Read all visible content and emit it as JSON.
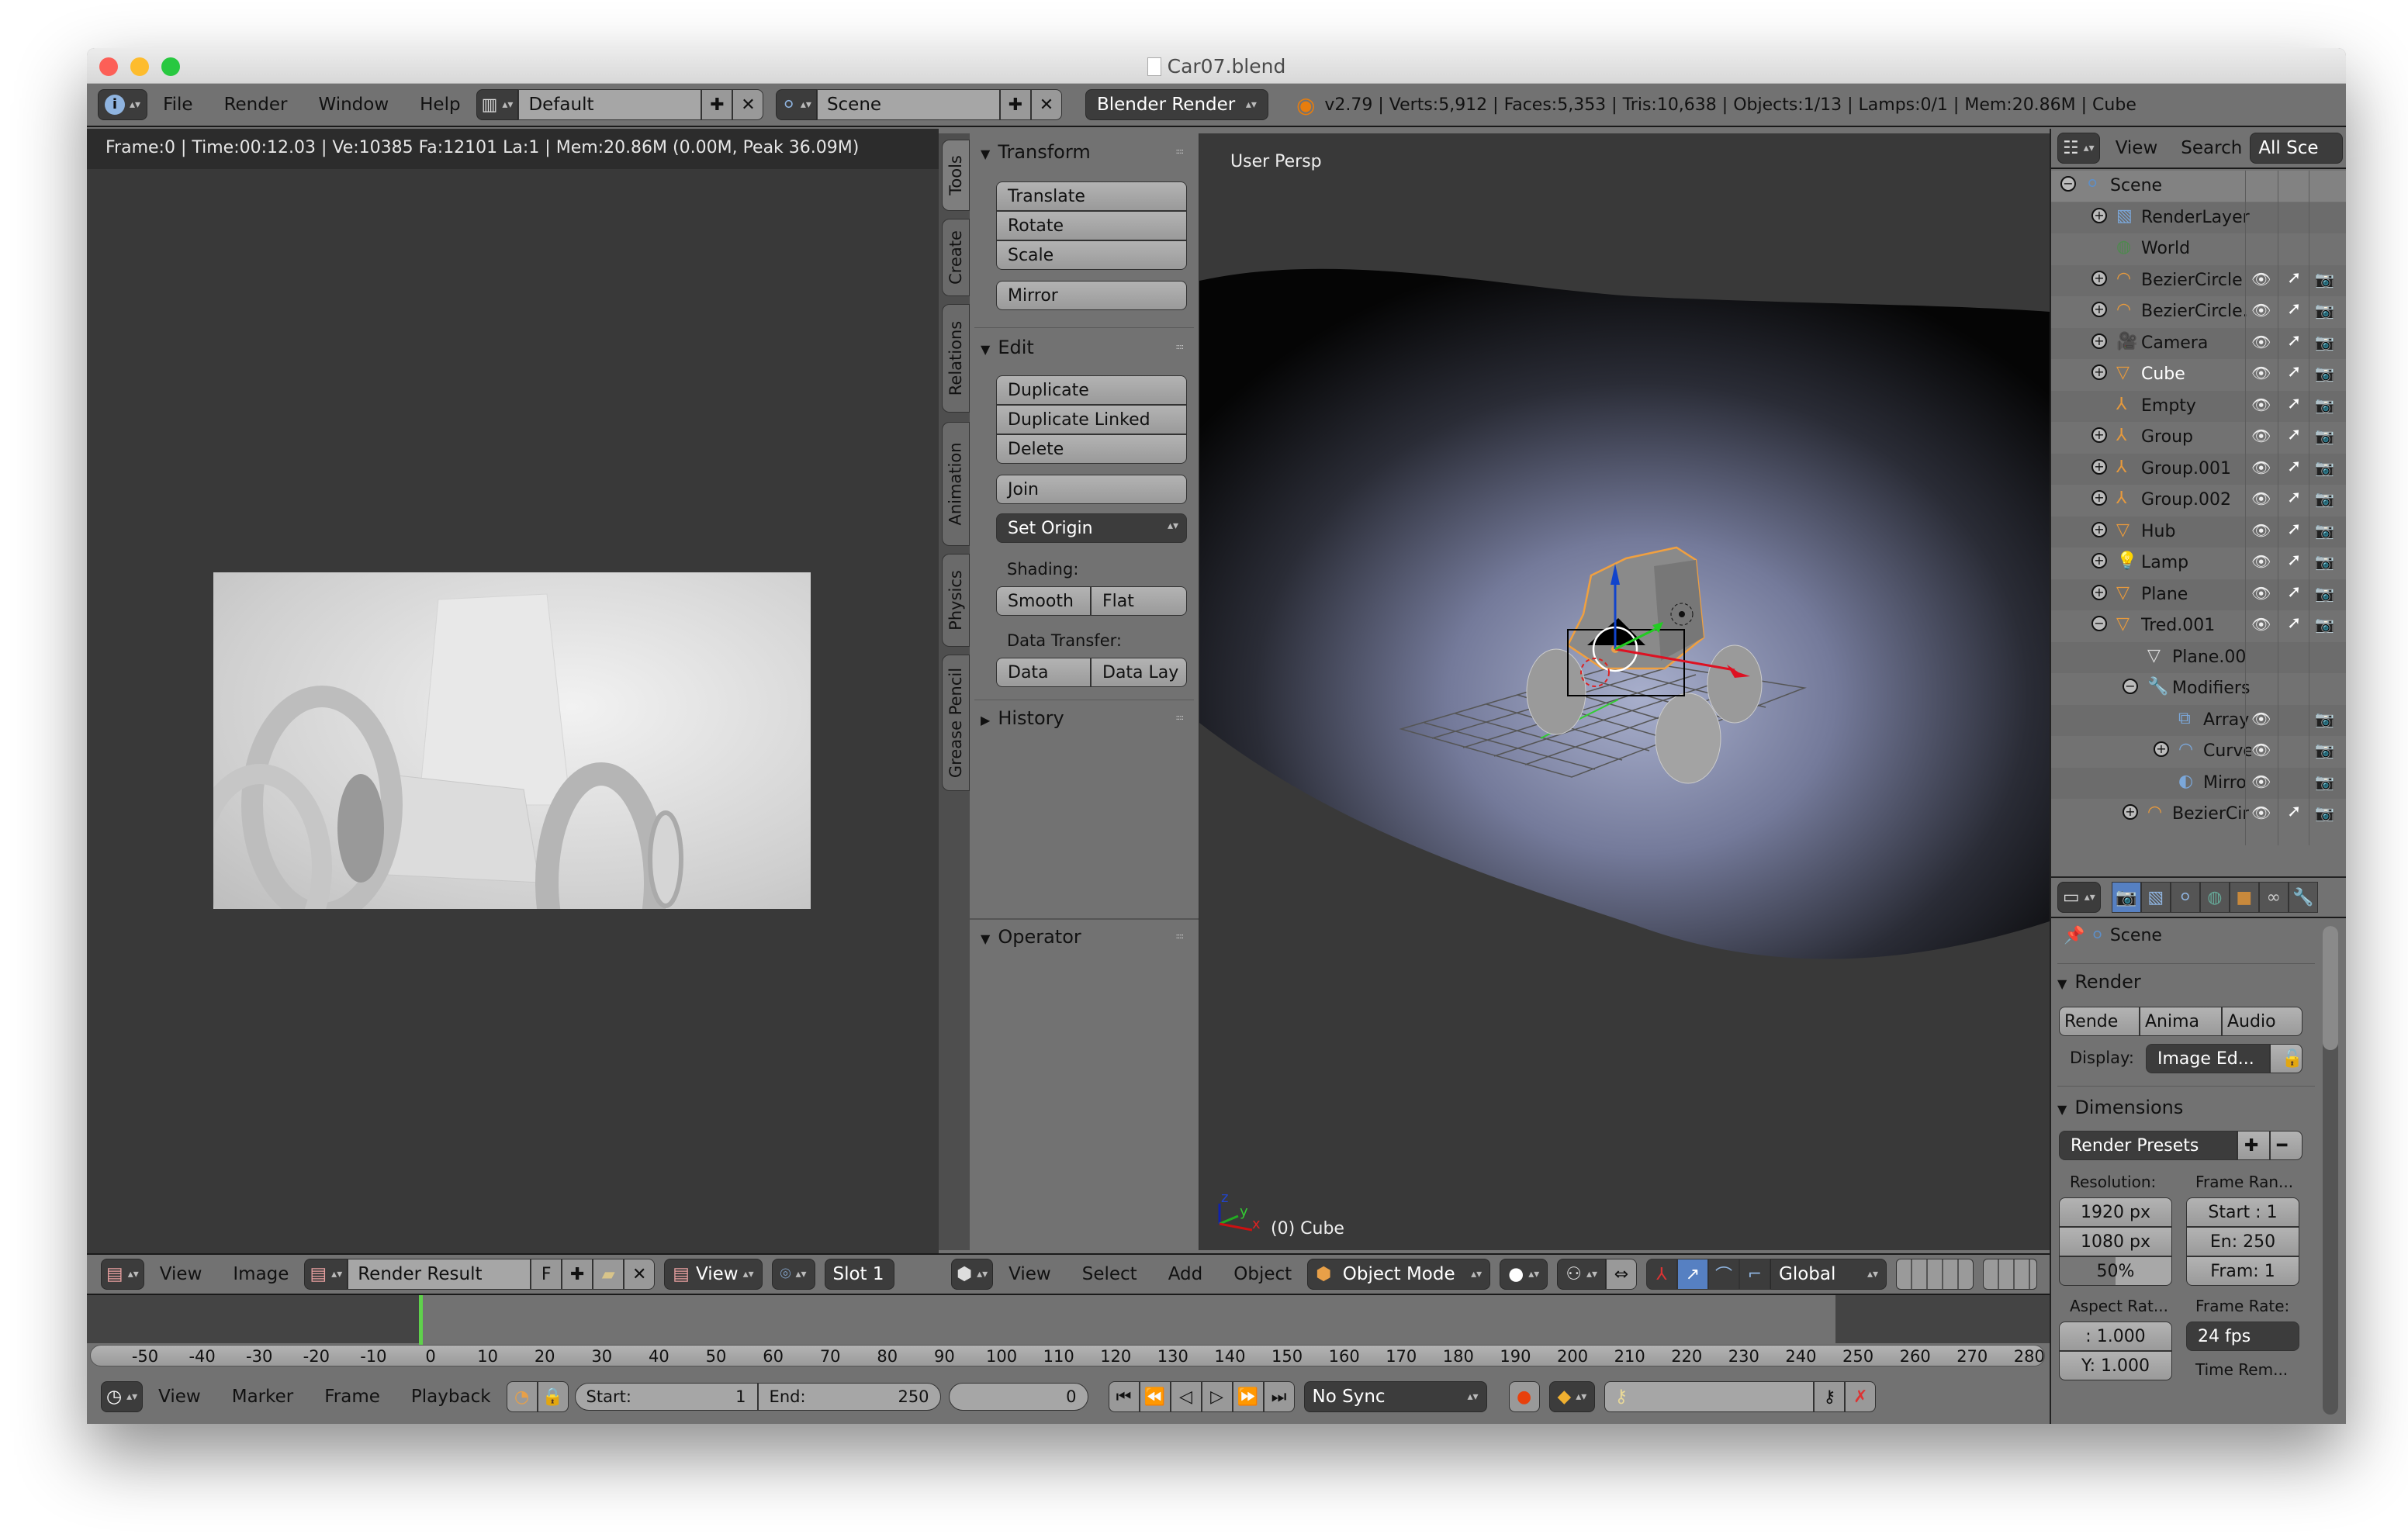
{
  "window": {
    "title": "Car07.blend",
    "traffic_lights": {
      "close": "#fc5f57",
      "minimize": "#fdbc2e",
      "zoom": "#28c840"
    }
  },
  "info_header": {
    "menus": [
      "File",
      "Render",
      "Window",
      "Help"
    ],
    "screen_layout": "Default",
    "scene": "Scene",
    "engine": "Blender Render",
    "stats": "v2.79 | Verts:5,912 | Faces:5,353 | Tris:10,638 | Objects:1/13 | Lamps:0/1 | Mem:20.86M | Cube"
  },
  "image_editor": {
    "render_info": "Frame:0 | Time:00:12.03 | Ve:10385 Fa:12101 La:1 | Mem:20.86M (0.00M, Peak 36.09M)",
    "header": {
      "menus": [
        "View",
        "Image"
      ],
      "image_name": "Render Result",
      "fake_user": "F",
      "view_mode": "View",
      "slot": "Slot 1"
    }
  },
  "tool_tabs": [
    "Tools",
    "Create",
    "Relations",
    "Animation",
    "Physics",
    "Grease Pencil"
  ],
  "tool_panel": {
    "transform": {
      "title": "Transform",
      "buttons": [
        "Translate",
        "Rotate",
        "Scale"
      ],
      "mirror": "Mirror"
    },
    "edit": {
      "title": "Edit",
      "buttons": [
        "Duplicate",
        "Duplicate Linked",
        "Delete"
      ],
      "join": "Join",
      "set_origin": "Set Origin",
      "shading_label": "Shading:",
      "shading": [
        "Smooth",
        "Flat"
      ],
      "data_transfer_label": "Data Transfer:",
      "data_transfer": [
        "Data",
        "Data Lay"
      ]
    },
    "history": {
      "title": "History"
    },
    "operator": {
      "title": "Operator"
    }
  },
  "viewport": {
    "view_name": "User Persp",
    "object_label": "(0) Cube",
    "axes": {
      "x": "x",
      "y": "y",
      "z": "z"
    },
    "header": {
      "menus": [
        "View",
        "Select",
        "Add",
        "Object"
      ],
      "mode": "Object Mode",
      "orientation": "Global"
    }
  },
  "outliner": {
    "header": {
      "menus": [
        "View",
        "Search"
      ],
      "filter": "All Sce"
    },
    "rows": [
      {
        "name": "Scene",
        "indent": 0,
        "expand": "minus",
        "icon": "scene",
        "color": "#5d8fc9",
        "vis": false
      },
      {
        "name": "RenderLayer",
        "indent": 1,
        "expand": "plus",
        "icon": "renderlayer",
        "color": "#7ba7d9",
        "vis": false
      },
      {
        "name": "World",
        "indent": 1,
        "expand": "",
        "icon": "world",
        "color": "#4d8a4d",
        "vis": false
      },
      {
        "name": "BezierCircle",
        "indent": 1,
        "expand": "plus",
        "icon": "curve",
        "color": "#e89a3c",
        "vis": true,
        "sel": true
      },
      {
        "name": "BezierCircle.",
        "indent": 1,
        "expand": "plus",
        "icon": "curve",
        "color": "#e89a3c",
        "vis": true,
        "sel": true
      },
      {
        "name": "Camera",
        "indent": 1,
        "expand": "plus",
        "icon": "camera",
        "color": "#e89a3c",
        "vis": true,
        "sel": true
      },
      {
        "name": "Cube",
        "indent": 1,
        "expand": "plus",
        "icon": "mesh",
        "color": "#e89a3c",
        "vis": true,
        "sel": true,
        "active": true
      },
      {
        "name": "Empty",
        "indent": 1,
        "expand": "",
        "icon": "empty",
        "color": "#e89a3c",
        "vis": true,
        "sel": true
      },
      {
        "name": "Group",
        "indent": 1,
        "expand": "plus",
        "icon": "empty",
        "color": "#e89a3c",
        "vis": true,
        "sel": true
      },
      {
        "name": "Group.001",
        "indent": 1,
        "expand": "plus",
        "icon": "empty",
        "color": "#e89a3c",
        "vis": true,
        "sel": true
      },
      {
        "name": "Group.002",
        "indent": 1,
        "expand": "plus",
        "icon": "empty",
        "color": "#e89a3c",
        "vis": true,
        "sel": true
      },
      {
        "name": "Hub",
        "indent": 1,
        "expand": "plus",
        "icon": "mesh",
        "color": "#e89a3c",
        "vis": true,
        "sel": true
      },
      {
        "name": "Lamp",
        "indent": 1,
        "expand": "plus",
        "icon": "lamp",
        "color": "#e89a3c",
        "vis": true,
        "sel": true
      },
      {
        "name": "Plane",
        "indent": 1,
        "expand": "plus",
        "icon": "mesh",
        "color": "#e89a3c",
        "vis": true,
        "sel": true
      },
      {
        "name": "Tred.001",
        "indent": 1,
        "expand": "minus",
        "icon": "mesh",
        "color": "#e89a3c",
        "vis": true,
        "sel": true
      },
      {
        "name": "Plane.00",
        "indent": 2,
        "expand": "",
        "icon": "meshdata",
        "color": "#ddd",
        "vis": false
      },
      {
        "name": "Modifiers",
        "indent": 2,
        "expand": "minus",
        "icon": "wrench",
        "color": "#7ba7d9",
        "vis": false
      },
      {
        "name": "Array",
        "indent": 3,
        "expand": "",
        "icon": "array",
        "color": "#7ba7d9",
        "vis": true,
        "sel": false
      },
      {
        "name": "Curve",
        "indent": 3,
        "expand": "plus",
        "icon": "curve",
        "color": "#7ba7d9",
        "vis": true,
        "sel": false
      },
      {
        "name": "Mirro",
        "indent": 3,
        "expand": "",
        "icon": "mirror",
        "color": "#7ba7d9",
        "vis": true,
        "sel": false
      },
      {
        "name": "BezierCir",
        "indent": 2,
        "expand": "plus",
        "icon": "curve",
        "color": "#e89a3c",
        "vis": true,
        "sel": true
      }
    ]
  },
  "properties": {
    "context": "Scene",
    "render": {
      "title": "Render",
      "buttons": [
        "Rende",
        "Anima",
        "Audio"
      ],
      "display_label": "Display:",
      "display_value": "Image Ed..."
    },
    "dimensions": {
      "title": "Dimensions",
      "presets": "Render Presets",
      "resolution_label": "Resolution:",
      "res_x": "1920 px",
      "res_y": "1080 px",
      "res_pct": "50%",
      "res_pct_value": 0.5,
      "frame_range_label": "Frame Ran...",
      "start": "Start : 1",
      "end": "En: 250",
      "frame": "Fram: 1",
      "aspect_label": "Aspect Rat...",
      "aspect_x": ":  1.000",
      "aspect_y": "Y: 1.000",
      "frame_rate_label": "Frame Rate:",
      "frame_rate": "24 fps",
      "time_remap_label": "Time Rem..."
    }
  },
  "timeline": {
    "ticks": [
      "-50",
      "-40",
      "-30",
      "-20",
      "-10",
      "0",
      "10",
      "20",
      "30",
      "40",
      "50",
      "60",
      "70",
      "80",
      "90",
      "100",
      "110",
      "120",
      "130",
      "140",
      "150",
      "160",
      "170",
      "180",
      "190",
      "200",
      "210",
      "220",
      "230",
      "240",
      "250",
      "260",
      "270",
      "280"
    ],
    "current_frame": 0,
    "menus": [
      "View",
      "Marker",
      "Frame",
      "Playback"
    ],
    "start_label": "Start:",
    "start_value": "1",
    "end_label": "End:",
    "end_value": "250",
    "frame_value": "0",
    "sync": "No Sync"
  }
}
